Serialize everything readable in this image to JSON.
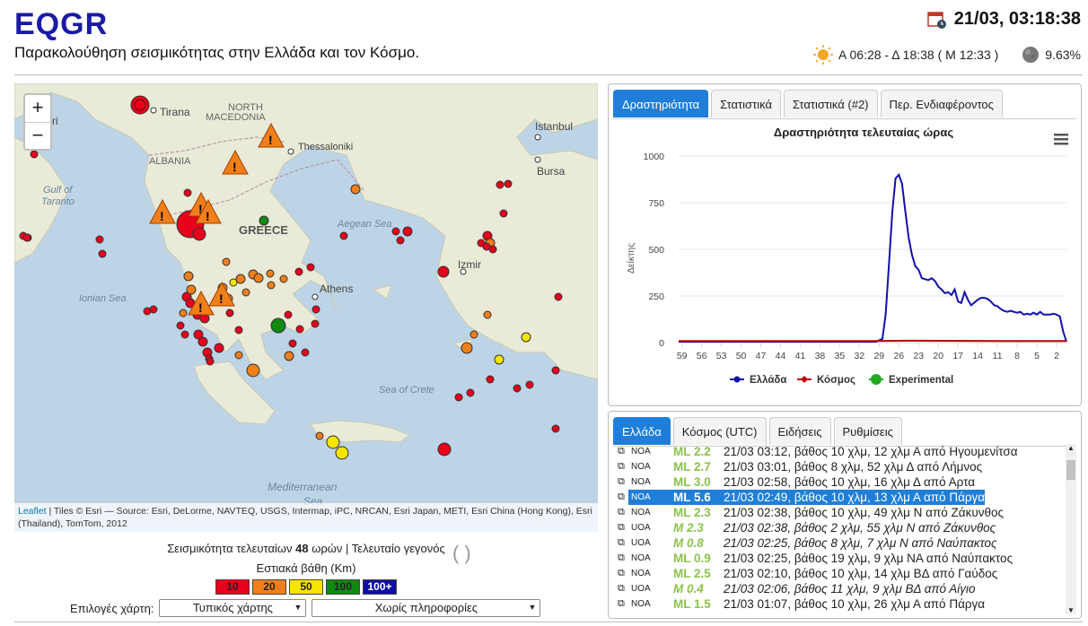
{
  "header": {
    "title": "EQGR",
    "subtitle": "Παρακολούθηση σεισμικότητας στην Ελλάδα και τον Κόσμο.",
    "datetime": "21/03, 03:18:38",
    "sun": "Α 06:28 - Δ 18:38 ( Μ 12:33 )",
    "moon": "9.63%"
  },
  "map": {
    "zoom_in": "+",
    "zoom_out": "−",
    "attribution_link": "Leaflet",
    "attribution": " | Tiles © Esri — Source: Esri, DeLorme, NAVTEQ, USGS, Intermap, iPC, NRCAN, Esri Japan, METI, Esri China (Hong Kong), Esri (Thailand), TomTom, 2012",
    "labels": [
      {
        "t": "Tirana"
      },
      {
        "t": "NORTH"
      },
      {
        "t": "MACEDONIA"
      },
      {
        "t": "Istanbul"
      },
      {
        "t": "Thessaloniki"
      },
      {
        "t": "ALBANIA"
      },
      {
        "t": "Bursa"
      },
      {
        "t": "Gulf of"
      },
      {
        "t": "Taranto"
      },
      {
        "t": "GREECE"
      },
      {
        "t": "Aegean Sea"
      },
      {
        "t": "Izmir"
      },
      {
        "t": "Ionian Sea"
      },
      {
        "t": "Athens"
      },
      {
        "t": "Sea of Crete"
      },
      {
        "t": "Mediterranean"
      },
      {
        "t": "Sea"
      },
      {
        "t": "ri"
      }
    ]
  },
  "legend": {
    "line1_a": "Σεισμικότητα τελευταίων ",
    "line1_b": "48",
    "line1_c": " ωρών  |  Τελευταίο γεγονός",
    "depth_title": "Εστιακά βάθη (Km)",
    "depths": [
      {
        "label": "10",
        "color": "#e8001c"
      },
      {
        "label": "20",
        "color": "#f07f1a"
      },
      {
        "label": "50",
        "color": "#f7e400"
      },
      {
        "label": "100",
        "color": "#128a12"
      },
      {
        "label": "100+",
        "color": "#1010a0"
      }
    ],
    "map_options_label": "Επιλογές χάρτη:",
    "map_type": "Τυπικός χάρτης",
    "map_info": "Χωρίς πληροφορίες"
  },
  "tabs1": [
    {
      "label": "Δραστηριότητα"
    },
    {
      "label": "Στατιστικά"
    },
    {
      "label": "Στατιστικά (#2)"
    },
    {
      "label": "Περ. Ενδιαφέροντος"
    }
  ],
  "tabs2": [
    {
      "label": "Ελλάδα"
    },
    {
      "label": "Κόσμος (UTC)"
    },
    {
      "label": "Ειδήσεις"
    },
    {
      "label": "Ρυθμίσεις"
    }
  ],
  "chart_data": {
    "type": "line",
    "title": "Δραστηριότητα τελευταίας ώρας",
    "ylabel": "Δείκτης",
    "xlabel": "",
    "x_ticks": [
      "59",
      "56",
      "53",
      "50",
      "47",
      "44",
      "41",
      "38",
      "35",
      "32",
      "29",
      "26",
      "23",
      "20",
      "17",
      "14",
      "11",
      "8",
      "5",
      "2"
    ],
    "ylim": [
      0,
      1000
    ],
    "y_ticks": [
      0,
      250,
      500,
      750,
      1000
    ],
    "x_range": [
      59.5,
      0.5
    ],
    "legend": "bottom",
    "series": [
      {
        "name": "Ελλάδα",
        "color": "#1010b0",
        "x": [
          59.5,
          52,
          40,
          32,
          29.5,
          28.5,
          28,
          27.5,
          27,
          26.5,
          26,
          25.5,
          25,
          24.5,
          24,
          23.5,
          23,
          22.5,
          22,
          21.5,
          21,
          20.5,
          20,
          19.5,
          19,
          18.5,
          18,
          17.5,
          17,
          16.5,
          16,
          15.5,
          15,
          14.5,
          14,
          13.5,
          13,
          12.5,
          12,
          11.5,
          11,
          10.5,
          10,
          9.5,
          9,
          8.5,
          8,
          7.5,
          7,
          6.5,
          6,
          5.5,
          5,
          4.5,
          4,
          3.5,
          3,
          2.5,
          2,
          1.5,
          1,
          0.5
        ],
        "y": [
          5,
          5,
          5,
          5,
          5,
          20,
          150,
          420,
          700,
          880,
          900,
          850,
          700,
          560,
          470,
          410,
          390,
          345,
          340,
          335,
          345,
          330,
          300,
          285,
          265,
          270,
          255,
          285,
          220,
          212,
          270,
          230,
          200,
          215,
          230,
          240,
          240,
          235,
          220,
          200,
          195,
          180,
          170,
          165,
          170,
          165,
          160,
          165,
          150,
          155,
          150,
          160,
          150,
          165,
          150,
          150,
          150,
          155,
          150,
          140,
          60,
          5
        ]
      },
      {
        "name": "Κόσμος",
        "color": "#c00000",
        "x": [
          59.5,
          30,
          25,
          10,
          0.5
        ],
        "y": [
          8,
          8,
          10,
          8,
          8
        ]
      },
      {
        "name": "Experimental",
        "color": "#22aa22",
        "x": [],
        "y": []
      }
    ]
  },
  "events": [
    {
      "src": "NOA",
      "mag": "ML 2.2",
      "txt": "21/03 03:12, βάθος 10 χλμ, 12 χλμ Α από Ηγουμενίτσα",
      "style": ""
    },
    {
      "src": "NOA",
      "mag": "ML 2.7",
      "txt": "21/03 03:01, βάθος 8 χλμ, 52 χλμ Δ από Λήμνος",
      "style": ""
    },
    {
      "src": "NOA",
      "mag": "ML 3.0",
      "txt": "21/03 02:58, βάθος 10 χλμ, 16 χλμ Δ από Αρτα",
      "style": ""
    },
    {
      "src": "NOA",
      "mag": "ML 5.6",
      "txt": "21/03 02:49, βάθος 10 χλμ, 13 χλμ Α από Πάργα",
      "style": "sel2"
    },
    {
      "src": "NOA",
      "mag": "ML 2.3",
      "txt": "21/03 02:38, βάθος 10 χλμ, 49 χλμ Ν από Ζάκυνθος",
      "style": ""
    },
    {
      "src": "UOA",
      "mag": "M 2.3",
      "txt": "21/03 02:38, βάθος 2 χλμ, 55 χλμ Ν από Ζάκυνθος",
      "style": "it"
    },
    {
      "src": "UOA",
      "mag": "M 0.8",
      "txt": "21/03 02:25, βάθος 8 χλμ, 7 χλμ Ν από Ναύπακτος",
      "style": "it"
    },
    {
      "src": "NOA",
      "mag": "ML 0.9",
      "txt": "21/03 02:25, βάθος 19 χλμ, 9 χλμ ΝΑ από Ναύπακτος",
      "style": ""
    },
    {
      "src": "NOA",
      "mag": "ML 2.5",
      "txt": "21/03 02:10, βάθος 10 χλμ, 14 χλμ ΒΔ από Γαύδος",
      "style": ""
    },
    {
      "src": "UOA",
      "mag": "M 0.4",
      "txt": "21/03 02:06, βάθος 11 χλμ, 9 χλμ ΒΔ από Αίγιο",
      "style": "it"
    },
    {
      "src": "NOA",
      "mag": "ML 1.5",
      "txt": "21/03 01:07, βάθος 10 χλμ, 26 χλμ Α από Πάργα",
      "style": ""
    }
  ]
}
